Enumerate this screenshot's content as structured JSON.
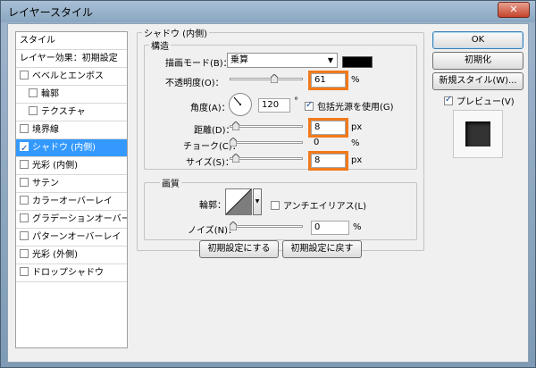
{
  "window": {
    "title": "レイヤースタイル",
    "close_glyph": "✕"
  },
  "style_list": {
    "header": "スタイル",
    "blend_item": "レイヤー効果：初期設定",
    "items": [
      {
        "label": "ベベルとエンボス",
        "checked": false
      },
      {
        "label": "輪郭",
        "checked": false
      },
      {
        "label": "テクスチャ",
        "checked": false
      },
      {
        "label": "境界線",
        "checked": false
      },
      {
        "label": "シャドウ (内側)",
        "checked": true
      },
      {
        "label": "光彩 (内側)",
        "checked": false
      },
      {
        "label": "サテン",
        "checked": false
      },
      {
        "label": "カラーオーバーレイ",
        "checked": false
      },
      {
        "label": "グラデーションオーバーレイ",
        "checked": false
      },
      {
        "label": "パターンオーバーレイ",
        "checked": false
      },
      {
        "label": "光彩 (外側)",
        "checked": false
      },
      {
        "label": "ドロップシャドウ",
        "checked": false
      }
    ]
  },
  "panel": {
    "title": "シャドウ (内側)",
    "structure": {
      "title": "構造",
      "blend_mode_label": "描画モード(B)：",
      "blend_mode_value": "乗算",
      "shadow_color": "#000000",
      "opacity_label": "不透明度(O)：",
      "opacity_value": "61",
      "opacity_unit": "%",
      "angle_label": "角度(A)：",
      "angle_value": "120",
      "angle_unit": "°",
      "global_light_label": "包括光源を使用(G)",
      "global_light_checked": true,
      "distance_label": "距離(D)：",
      "distance_value": "8",
      "distance_unit": "px",
      "choke_label": "チョーク(C)：",
      "choke_value": "0",
      "choke_unit": "%",
      "size_label": "サイズ(S)：",
      "size_value": "8",
      "size_unit": "px"
    },
    "quality": {
      "title": "画質",
      "contour_label": "輪郭：",
      "antialias_label": "アンチエイリアス(L)",
      "antialias_checked": false,
      "noise_label": "ノイズ(N)：",
      "noise_value": "0",
      "noise_unit": "%"
    },
    "make_default_label": "初期設定にする",
    "reset_default_label": "初期設定に戻す"
  },
  "buttons": {
    "ok": "OK",
    "reset": "初期化",
    "new_style": "新規スタイル(W)...",
    "preview_label": "プレビュー(V)",
    "preview_checked": true
  },
  "accent_color": "#f27a1a"
}
